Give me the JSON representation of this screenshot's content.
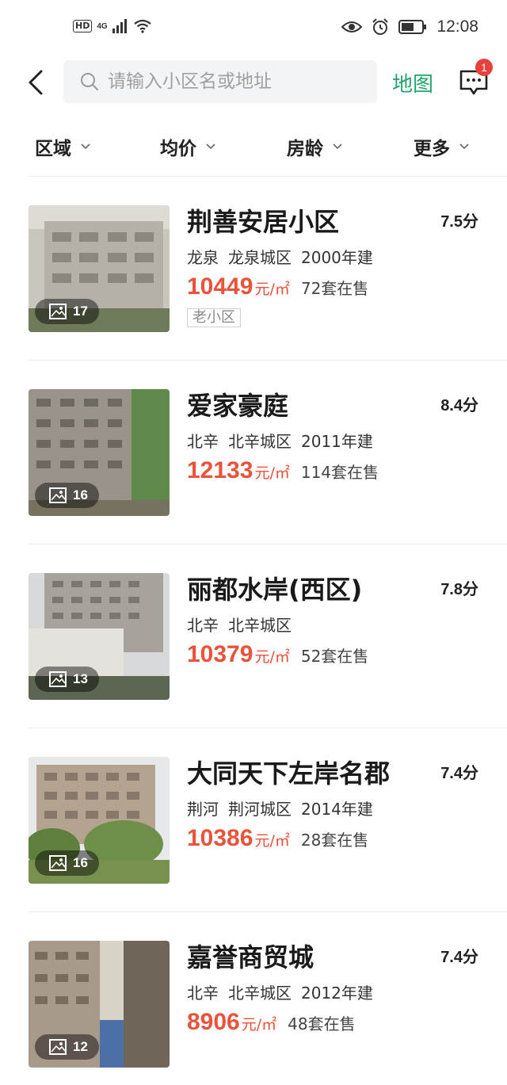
{
  "status_bar": {
    "hd": "HD",
    "network": "4G",
    "time": "12:08"
  },
  "header": {
    "search_placeholder": "请输入小区名或地址",
    "map_label": "地图",
    "message_badge": "1"
  },
  "filters": [
    {
      "label": "区域"
    },
    {
      "label": "均价"
    },
    {
      "label": "房龄"
    },
    {
      "label": "更多"
    }
  ],
  "listings": [
    {
      "name": "荆善安居小区",
      "score": "7.5分",
      "district": "龙泉",
      "area": "龙泉城区",
      "year": "2000年建",
      "price": "10449",
      "unit": "元/㎡",
      "on_sale": "72套在售",
      "tag": "老小区",
      "photos": "17",
      "color": "#b5b1a6"
    },
    {
      "name": "爱家豪庭",
      "score": "8.4分",
      "district": "北辛",
      "area": "北辛城区",
      "year": "2011年建",
      "price": "12133",
      "unit": "元/㎡",
      "on_sale": "114套在售",
      "tag": "",
      "photos": "16",
      "color": "#9a938a"
    },
    {
      "name": "丽都水岸(西区)",
      "score": "7.8分",
      "district": "北辛",
      "area": "北辛城区",
      "year": "",
      "price": "10379",
      "unit": "元/㎡",
      "on_sale": "52套在售",
      "tag": "",
      "photos": "13",
      "color": "#a7a29c"
    },
    {
      "name": "大同天下左岸名郡",
      "score": "7.4分",
      "district": "荆河",
      "area": "荆河城区",
      "year": "2014年建",
      "price": "10386",
      "unit": "元/㎡",
      "on_sale": "28套在售",
      "tag": "",
      "photos": "16",
      "color": "#b3a38f"
    },
    {
      "name": "嘉誉商贸城",
      "score": "7.4分",
      "district": "北辛",
      "area": "北辛城区",
      "year": "2012年建",
      "price": "8906",
      "unit": "元/㎡",
      "on_sale": "48套在售",
      "tag": "",
      "photos": "12",
      "color": "#a89a8a"
    }
  ]
}
